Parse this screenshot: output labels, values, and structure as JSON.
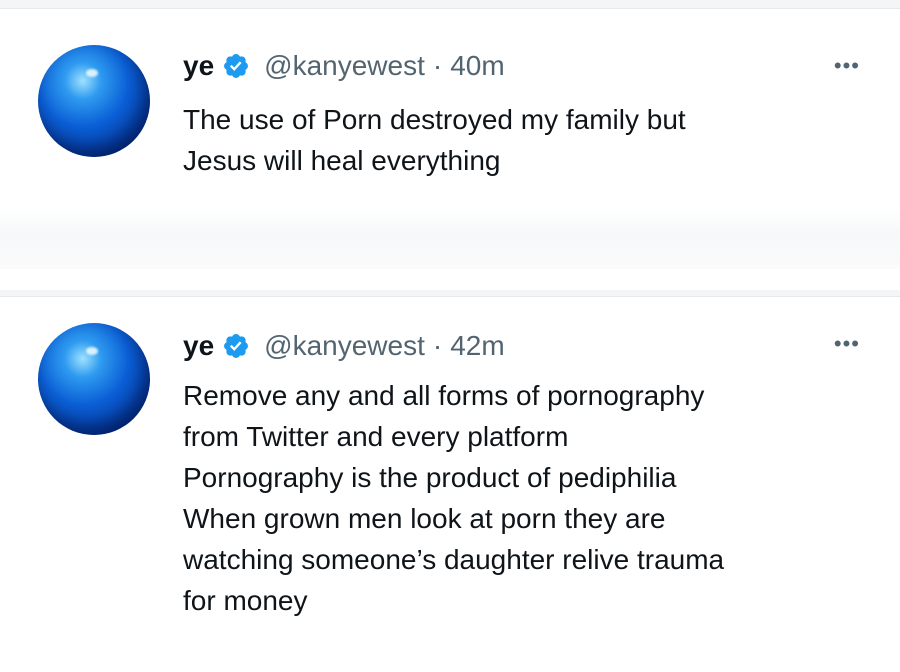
{
  "tweets": [
    {
      "name": "ye",
      "handle": "@kanyewest",
      "separator": "·",
      "time": "40m",
      "more": "•••",
      "lines": [
        "The use of Porn destroyed my family but",
        "Jesus will heal everything"
      ]
    },
    {
      "name": "ye",
      "handle": "@kanyewest",
      "separator": "·",
      "time": "42m",
      "more": "•••",
      "lines": [
        "Remove any and all forms of pornography",
        "from Twitter and every platform",
        "Pornography is the product of pediphilia",
        "When grown men look at porn they are",
        "watching someone’s daughter relive trauma",
        "for money"
      ]
    }
  ],
  "colors": {
    "verified_badge": "#1d9bf0",
    "secondary_text": "#536471",
    "primary_text": "#0f1419"
  },
  "icons": {
    "verified": "verified-badge-icon",
    "more": "more-options-icon"
  }
}
